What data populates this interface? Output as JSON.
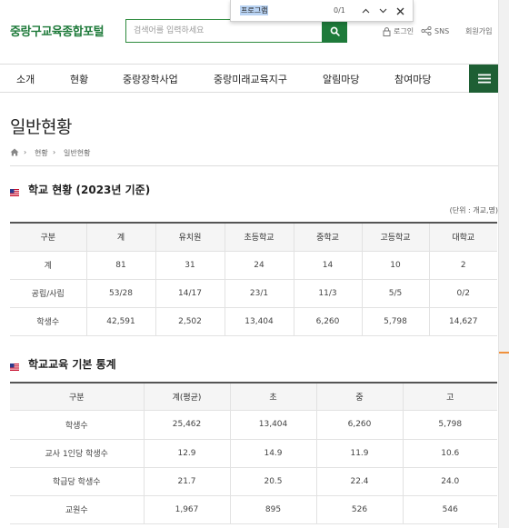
{
  "header": {
    "logo": "중랑구교육종합포털",
    "search_placeholder": "검색어를 입력하세요",
    "login": "로그인",
    "sns": "SNS",
    "join": "회원가입"
  },
  "findbar": {
    "query": "프로그램",
    "count": "0/1"
  },
  "nav": {
    "items": [
      "소개",
      "현황",
      "중랑장학사업",
      "중랑미래교육지구",
      "알림마당",
      "참여마당"
    ]
  },
  "page": {
    "title": "일반현황",
    "breadcrumb": [
      "현황",
      "일반현황"
    ]
  },
  "section1": {
    "title": "학교 현황 (2023년 기준)",
    "unit": "(단위 : 개교,명)",
    "headers": [
      "구분",
      "계",
      "유치원",
      "초등학교",
      "중학교",
      "고등학교",
      "대학교"
    ],
    "rows": [
      [
        "계",
        "81",
        "31",
        "24",
        "14",
        "10",
        "2"
      ],
      [
        "공립/사립",
        "53/28",
        "14/17",
        "23/1",
        "11/3",
        "5/5",
        "0/2"
      ],
      [
        "학생수",
        "42,591",
        "2,502",
        "13,404",
        "6,260",
        "5,798",
        "14,627"
      ]
    ]
  },
  "section2": {
    "title": "학교교육 기본 통계",
    "headers": [
      "구분",
      "계(평균)",
      "초",
      "중",
      "고"
    ],
    "rows": [
      [
        "학생수",
        "25,462",
        "13,404",
        "6,260",
        "5,798"
      ],
      [
        "교사 1인당 학생수",
        "12.9",
        "14.9",
        "11.9",
        "10.6"
      ],
      [
        "학급당 학생수",
        "21.7",
        "20.5",
        "22.4",
        "24.0"
      ],
      [
        "교원수",
        "1,967",
        "895",
        "526",
        "546"
      ]
    ]
  },
  "colors": {
    "brand_green": "#1e7a3a",
    "menu_green": "#1e5f34",
    "find_highlight": "#b9d3f3",
    "scroll_marker": "#f0913c"
  }
}
